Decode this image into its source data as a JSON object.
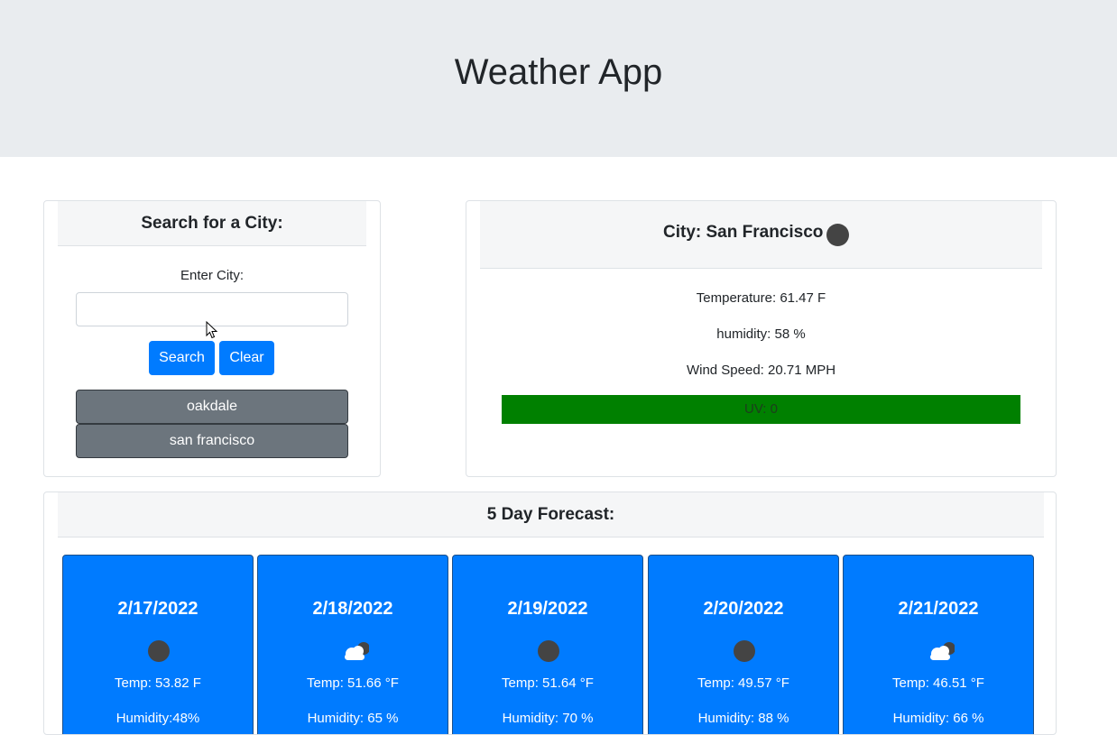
{
  "header": {
    "title": "Weather App"
  },
  "search": {
    "title": "Search for a City:",
    "label": "Enter City:",
    "input_value": "",
    "search_label": "Search",
    "clear_label": "Clear",
    "history": [
      "oakdale",
      "san francisco"
    ]
  },
  "current": {
    "city_heading": "City: San Francisco",
    "icon": "moon-icon",
    "temperature": "Temperature: 61.47 F",
    "humidity": "humidity: 58 %",
    "wind": "Wind Speed: 20.71 MPH",
    "uv": "UV: 0",
    "uv_color": "#008000"
  },
  "forecast": {
    "title": "5 Day Forecast:",
    "days": [
      {
        "date": "2/17/2022",
        "icon": "moon-icon",
        "temp": "Temp: 53.82 F",
        "humidity": "Humidity:48%"
      },
      {
        "date": "2/18/2022",
        "icon": "cloud-moon-icon",
        "temp": "Temp: 51.66 °F",
        "humidity": "Humidity: 65 %"
      },
      {
        "date": "2/19/2022",
        "icon": "moon-icon",
        "temp": "Temp: 51.64 °F",
        "humidity": "Humidity: 70 %"
      },
      {
        "date": "2/20/2022",
        "icon": "moon-icon",
        "temp": "Temp: 49.57 °F",
        "humidity": "Humidity: 88 %"
      },
      {
        "date": "2/21/2022",
        "icon": "cloud-moon-icon",
        "temp": "Temp: 46.51 °F",
        "humidity": "Humidity: 66 %"
      }
    ]
  },
  "colors": {
    "primary": "#007bff",
    "secondary": "#6c757d",
    "uv_low": "#008000",
    "jumbotron": "#e9ecef"
  }
}
